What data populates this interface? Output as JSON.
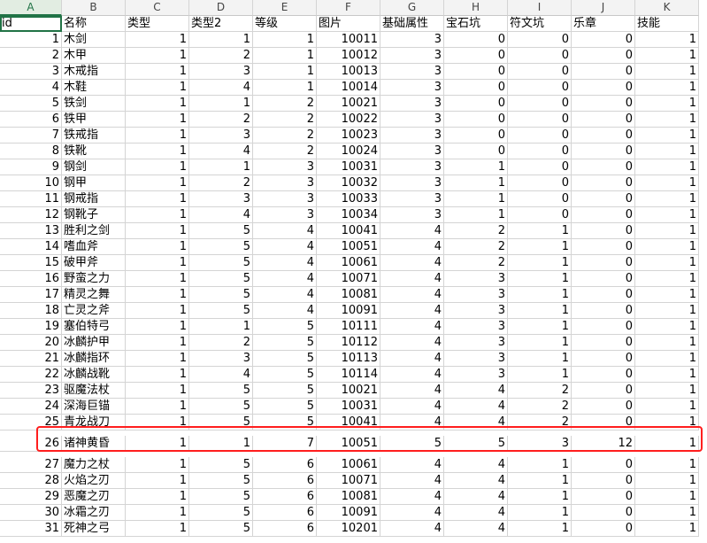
{
  "colors": {
    "accent": "#217346",
    "highlight": "#ff1e1e",
    "grid": "#d4d4d4"
  },
  "column_letters": [
    "A",
    "B",
    "C",
    "D",
    "E",
    "F",
    "G",
    "H",
    "I",
    "J",
    "K"
  ],
  "header": [
    "id",
    "名称",
    "类型",
    "类型2",
    "等级",
    "图片",
    "基础属性",
    "宝石坑",
    "符文坑",
    "乐章",
    "技能"
  ],
  "rows": [
    [
      "1",
      "木剑",
      "1",
      "1",
      "1",
      "10011",
      "3",
      "0",
      "0",
      "0",
      "1"
    ],
    [
      "2",
      "木甲",
      "1",
      "2",
      "1",
      "10012",
      "3",
      "0",
      "0",
      "0",
      "1"
    ],
    [
      "3",
      "木戒指",
      "1",
      "3",
      "1",
      "10013",
      "3",
      "0",
      "0",
      "0",
      "1"
    ],
    [
      "4",
      "木鞋",
      "1",
      "4",
      "1",
      "10014",
      "3",
      "0",
      "0",
      "0",
      "1"
    ],
    [
      "5",
      "铁剑",
      "1",
      "1",
      "2",
      "10021",
      "3",
      "0",
      "0",
      "0",
      "1"
    ],
    [
      "6",
      "铁甲",
      "1",
      "2",
      "2",
      "10022",
      "3",
      "0",
      "0",
      "0",
      "1"
    ],
    [
      "7",
      "铁戒指",
      "1",
      "3",
      "2",
      "10023",
      "3",
      "0",
      "0",
      "0",
      "1"
    ],
    [
      "8",
      "铁靴",
      "1",
      "4",
      "2",
      "10024",
      "3",
      "0",
      "0",
      "0",
      "1"
    ],
    [
      "9",
      "钢剑",
      "1",
      "1",
      "3",
      "10031",
      "3",
      "1",
      "0",
      "0",
      "1"
    ],
    [
      "10",
      "钢甲",
      "1",
      "2",
      "3",
      "10032",
      "3",
      "1",
      "0",
      "0",
      "1"
    ],
    [
      "11",
      "钢戒指",
      "1",
      "3",
      "3",
      "10033",
      "3",
      "1",
      "0",
      "0",
      "1"
    ],
    [
      "12",
      "钢靴子",
      "1",
      "4",
      "3",
      "10034",
      "3",
      "1",
      "0",
      "0",
      "1"
    ],
    [
      "13",
      "胜利之剑",
      "1",
      "5",
      "4",
      "10041",
      "4",
      "2",
      "1",
      "0",
      "1"
    ],
    [
      "14",
      "嗜血斧",
      "1",
      "5",
      "4",
      "10051",
      "4",
      "2",
      "1",
      "0",
      "1"
    ],
    [
      "15",
      "破甲斧",
      "1",
      "5",
      "4",
      "10061",
      "4",
      "2",
      "1",
      "0",
      "1"
    ],
    [
      "16",
      "野蛮之力",
      "1",
      "5",
      "4",
      "10071",
      "4",
      "3",
      "1",
      "0",
      "1"
    ],
    [
      "17",
      "精灵之舞",
      "1",
      "5",
      "4",
      "10081",
      "4",
      "3",
      "1",
      "0",
      "1"
    ],
    [
      "18",
      "亡灵之斧",
      "1",
      "5",
      "4",
      "10091",
      "4",
      "3",
      "1",
      "0",
      "1"
    ],
    [
      "19",
      "塞伯特弓",
      "1",
      "1",
      "5",
      "10111",
      "4",
      "3",
      "1",
      "0",
      "1"
    ],
    [
      "20",
      "冰麟护甲",
      "1",
      "2",
      "5",
      "10112",
      "4",
      "3",
      "1",
      "0",
      "1"
    ],
    [
      "21",
      "冰麟指环",
      "1",
      "3",
      "5",
      "10113",
      "4",
      "3",
      "1",
      "0",
      "1"
    ],
    [
      "22",
      "冰麟战靴",
      "1",
      "4",
      "5",
      "10114",
      "4",
      "3",
      "1",
      "0",
      "1"
    ],
    [
      "23",
      "驱魔法杖",
      "1",
      "5",
      "5",
      "10021",
      "4",
      "4",
      "2",
      "0",
      "1"
    ],
    [
      "24",
      "深海巨锚",
      "1",
      "5",
      "5",
      "10031",
      "4",
      "4",
      "2",
      "0",
      "1"
    ],
    [
      "25",
      "青龙战刀",
      "1",
      "5",
      "5",
      "10041",
      "4",
      "4",
      "2",
      "0",
      "1"
    ],
    [
      "26",
      "诸神黄昏",
      "1",
      "1",
      "7",
      "10051",
      "5",
      "5",
      "3",
      "12",
      "1"
    ],
    [
      "27",
      "魔力之杖",
      "1",
      "5",
      "6",
      "10061",
      "4",
      "4",
      "1",
      "0",
      "1"
    ],
    [
      "28",
      "火焰之刃",
      "1",
      "5",
      "6",
      "10071",
      "4",
      "4",
      "1",
      "0",
      "1"
    ],
    [
      "29",
      "恶魔之刃",
      "1",
      "5",
      "6",
      "10081",
      "4",
      "4",
      "1",
      "0",
      "1"
    ],
    [
      "30",
      "冰霜之刃",
      "1",
      "5",
      "6",
      "10091",
      "4",
      "4",
      "1",
      "0",
      "1"
    ],
    [
      "31",
      "死神之弓",
      "1",
      "5",
      "6",
      "10201",
      "4",
      "4",
      "1",
      "0",
      "1"
    ]
  ]
}
